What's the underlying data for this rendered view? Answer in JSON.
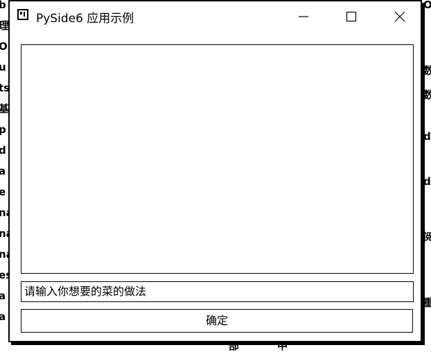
{
  "window": {
    "title": "PySide6 应用示例",
    "icon": "app-window-icon",
    "controls": [
      "minimize-icon",
      "maximize-icon",
      "close-icon"
    ]
  },
  "main": {
    "output_text": "",
    "input_placeholder": "请输入你想要的菜的做法",
    "confirm_label": "确定"
  },
  "background": {
    "left_fragments": [
      "b",
      "理",
      "O",
      "u",
      "ts",
      "基",
      "p",
      "d",
      "a",
      "e",
      "na",
      "na",
      "na",
      "es",
      "a",
      "a"
    ],
    "right_fragments": [
      "O",
      "数",
      "数",
      "di",
      "d",
      "阅",
      "重"
    ],
    "bottom_fragments": [
      "部",
      "中"
    ]
  }
}
